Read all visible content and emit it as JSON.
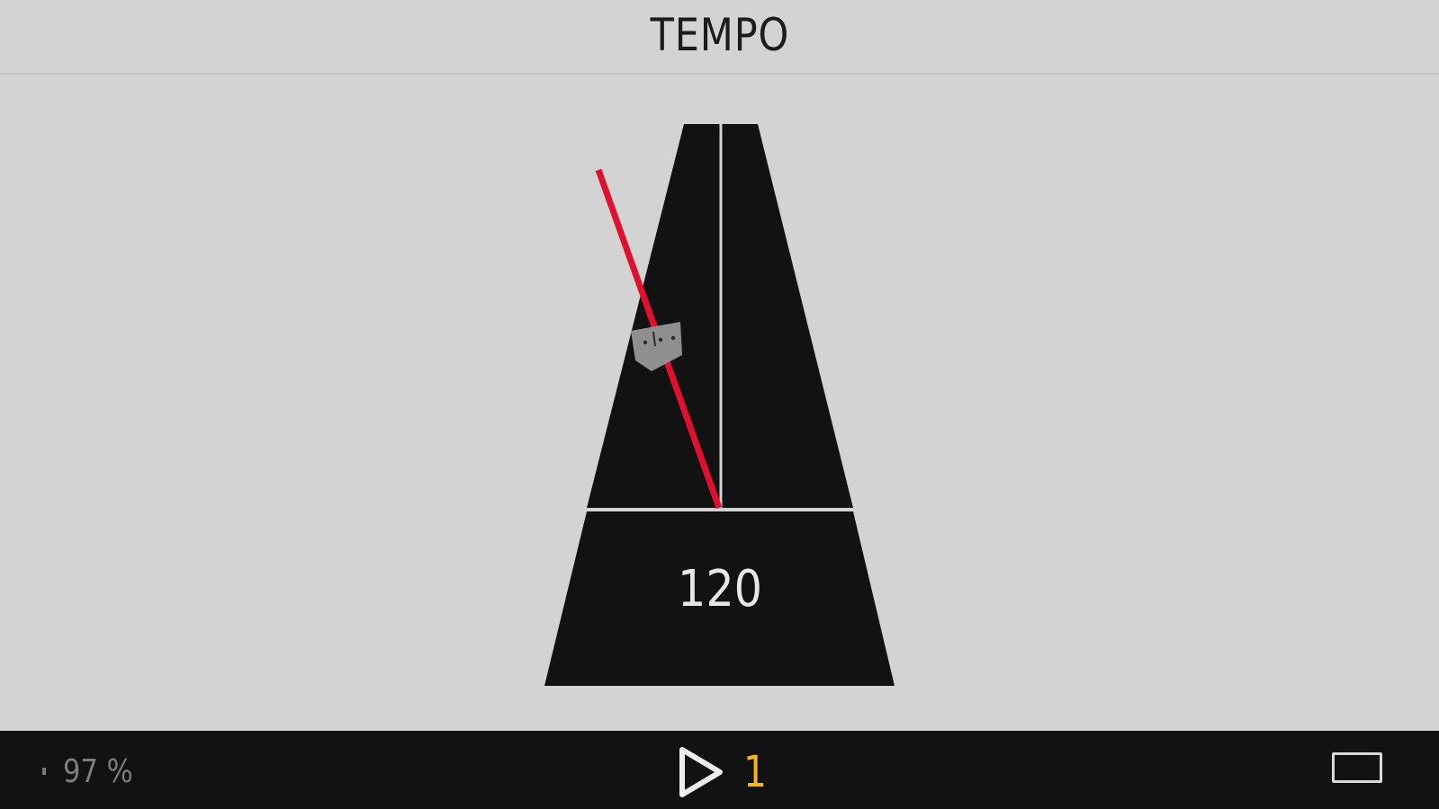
{
  "header": {
    "title": "TEMPO"
  },
  "metronome": {
    "bpm": "120",
    "pendulum_color": "#e0112e",
    "body_color": "#121212",
    "weight_color": "#8f8f8f"
  },
  "footer": {
    "battery_icon": "battery-icon",
    "battery_text": "97 %",
    "play_icon": "play-icon",
    "count": "1",
    "count_color": "#f0b81c",
    "screen_icon": "rectangle-icon"
  }
}
